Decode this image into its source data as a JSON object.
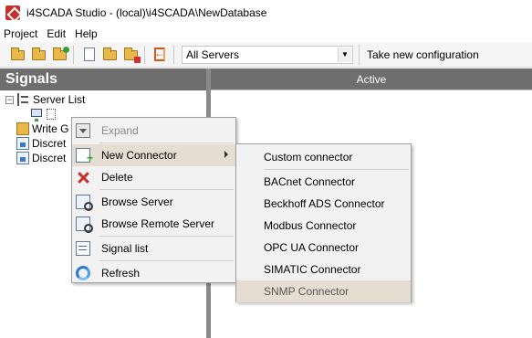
{
  "window": {
    "title": "i4SCADA Studio - (local)\\i4SCADA\\NewDatabase"
  },
  "menu": [
    "Project",
    "Edit",
    "Help"
  ],
  "toolbar": {
    "server_select": "All Servers",
    "take_config": "Take new configuration"
  },
  "signals_panel": {
    "title": "Signals",
    "tree": {
      "server_list": "Server List",
      "write_group": "Write G",
      "discrete_1": "Discret",
      "discrete_2": "Discret"
    }
  },
  "right_panel": {
    "column_header": "Active"
  },
  "context_menu": {
    "expand": "Expand",
    "new_connector": "New Connector",
    "delete": "Delete",
    "browse_server": "Browse Server",
    "browse_remote_server": "Browse Remote Server",
    "signal_list": "Signal list",
    "refresh": "Refresh"
  },
  "submenu": {
    "custom": "Custom connector",
    "bacnet": "BACnet Connector",
    "beckhoff": "Beckhoff ADS Connector",
    "modbus": "Modbus Connector",
    "opcua": "OPC UA Connector",
    "simatic": "SIMATIC Connector",
    "snmp": "SNMP Connector"
  },
  "colors": {
    "header_gray": "#6e6e6e",
    "menu_highlight": "#e6ddd2",
    "brand_red": "#c8302a"
  }
}
